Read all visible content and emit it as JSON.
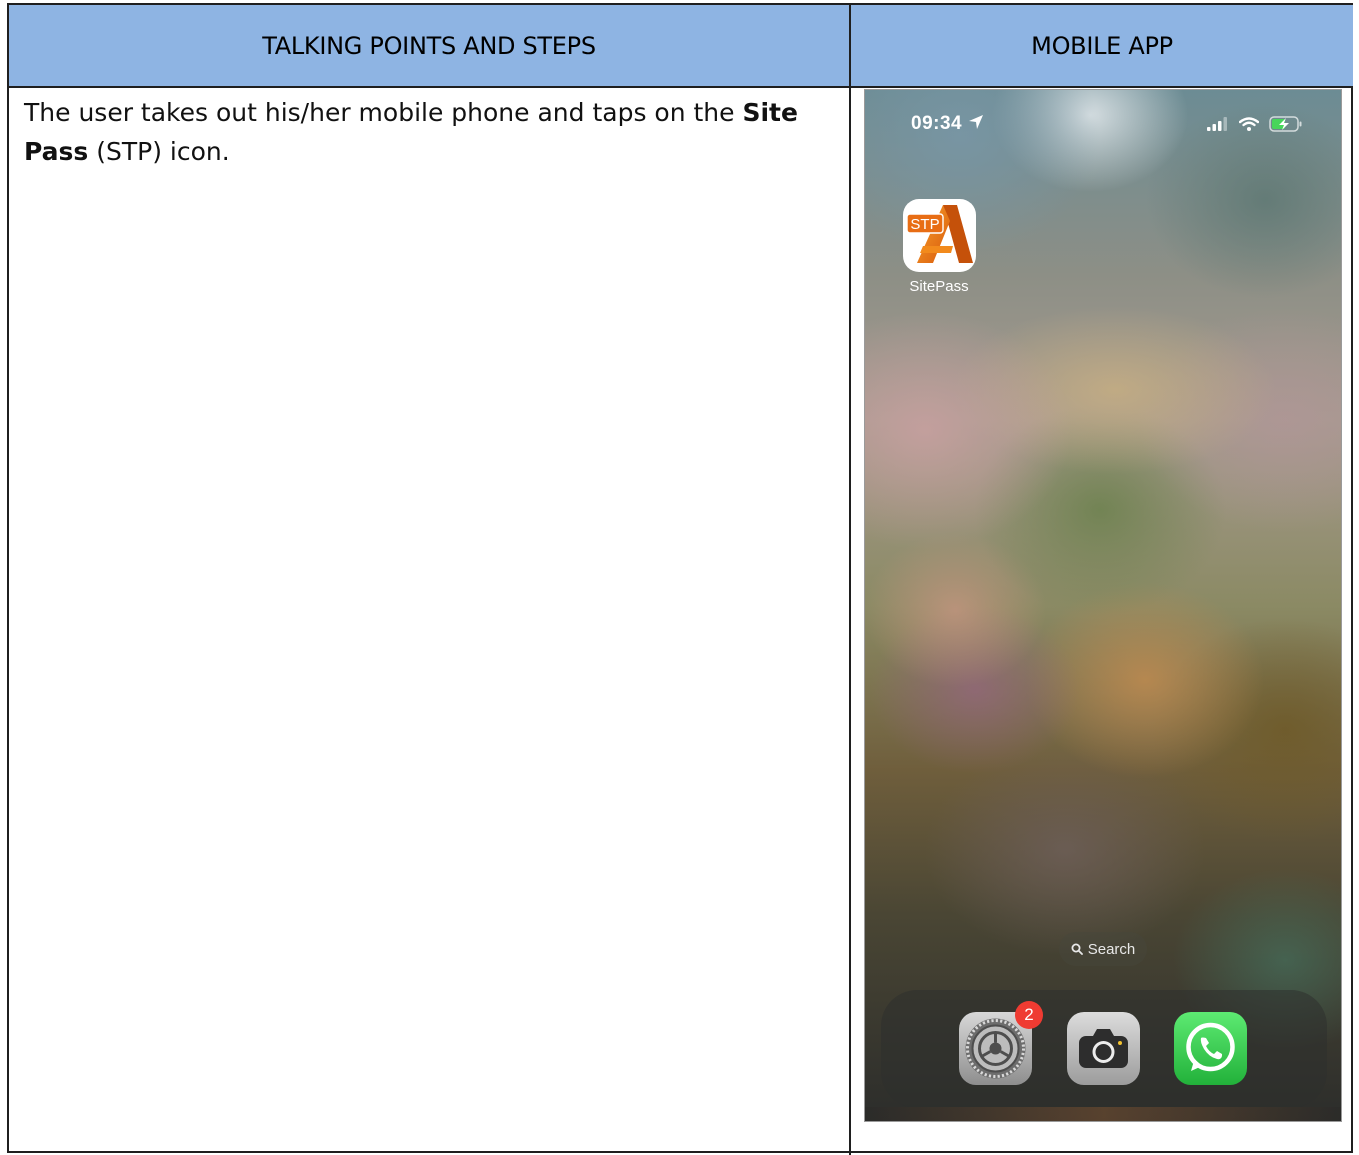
{
  "table": {
    "col_left_header": "TALKING POINTS AND STEPS",
    "col_right_header": "MOBILE APP"
  },
  "step": {
    "text_before": "The user takes out his/her mobile phone and taps on the ",
    "text_bold": "Site Pass",
    "text_after": " (STP) icon."
  },
  "phone": {
    "time": "09:34",
    "icons": [
      "location-arrow-icon",
      "signal-bars-icon",
      "wifi-icon",
      "battery-charging-icon"
    ],
    "app": {
      "name": "SitePass",
      "icon_text": "STP"
    },
    "search_label": "Search",
    "dock": {
      "apps": [
        "settings-app",
        "camera-app",
        "whatsapp-app"
      ],
      "settings_badge": "2"
    }
  },
  "colors": {
    "header_bg": "#8eb4e3",
    "badge": "#ef3b32",
    "stp_orange": "#f07a13",
    "whatsapp_green": "#2fc24a"
  }
}
